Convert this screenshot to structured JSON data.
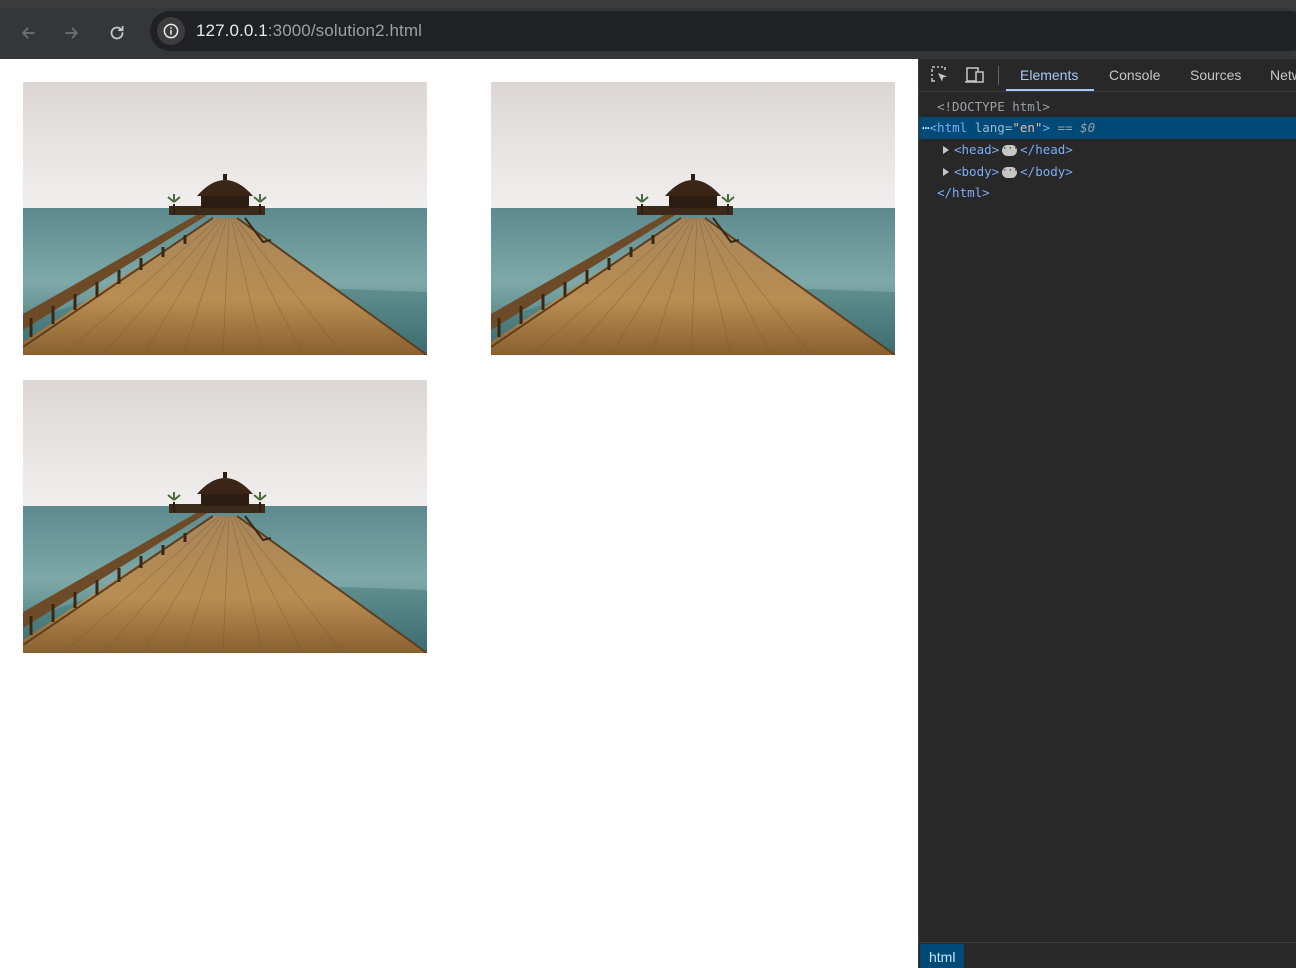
{
  "browser": {
    "url_host": "127.0.0.1",
    "url_rest": ":3000/solution2.html",
    "nav": [
      "back-icon",
      "forward-icon",
      "reload-icon"
    ]
  },
  "page": {
    "images": [
      {
        "alt": "wooden pier leading to a gazebo over the sea"
      },
      {
        "alt": "wooden pier leading to a gazebo over the sea"
      },
      {
        "alt": "wooden pier leading to a gazebo over the sea"
      }
    ]
  },
  "devtools": {
    "tabs": [
      "Elements",
      "Console",
      "Sources",
      "Netw"
    ],
    "active_tab": "Elements",
    "tree": {
      "doctype": "<!DOCTYPE html>",
      "html_open": "<html",
      "html_attr": "lang",
      "html_val": "\"en\"",
      "html_suffix": "== $0",
      "head_open": "<head>",
      "head_close": "</head>",
      "body_open": "<body>",
      "body_close": "</body>",
      "html_close": "</html>"
    },
    "breadcrumb": "html",
    "colors": {
      "selected_row": "#004a77",
      "tag": "#7cacf8",
      "active_tab": "#a8c7fa"
    }
  }
}
